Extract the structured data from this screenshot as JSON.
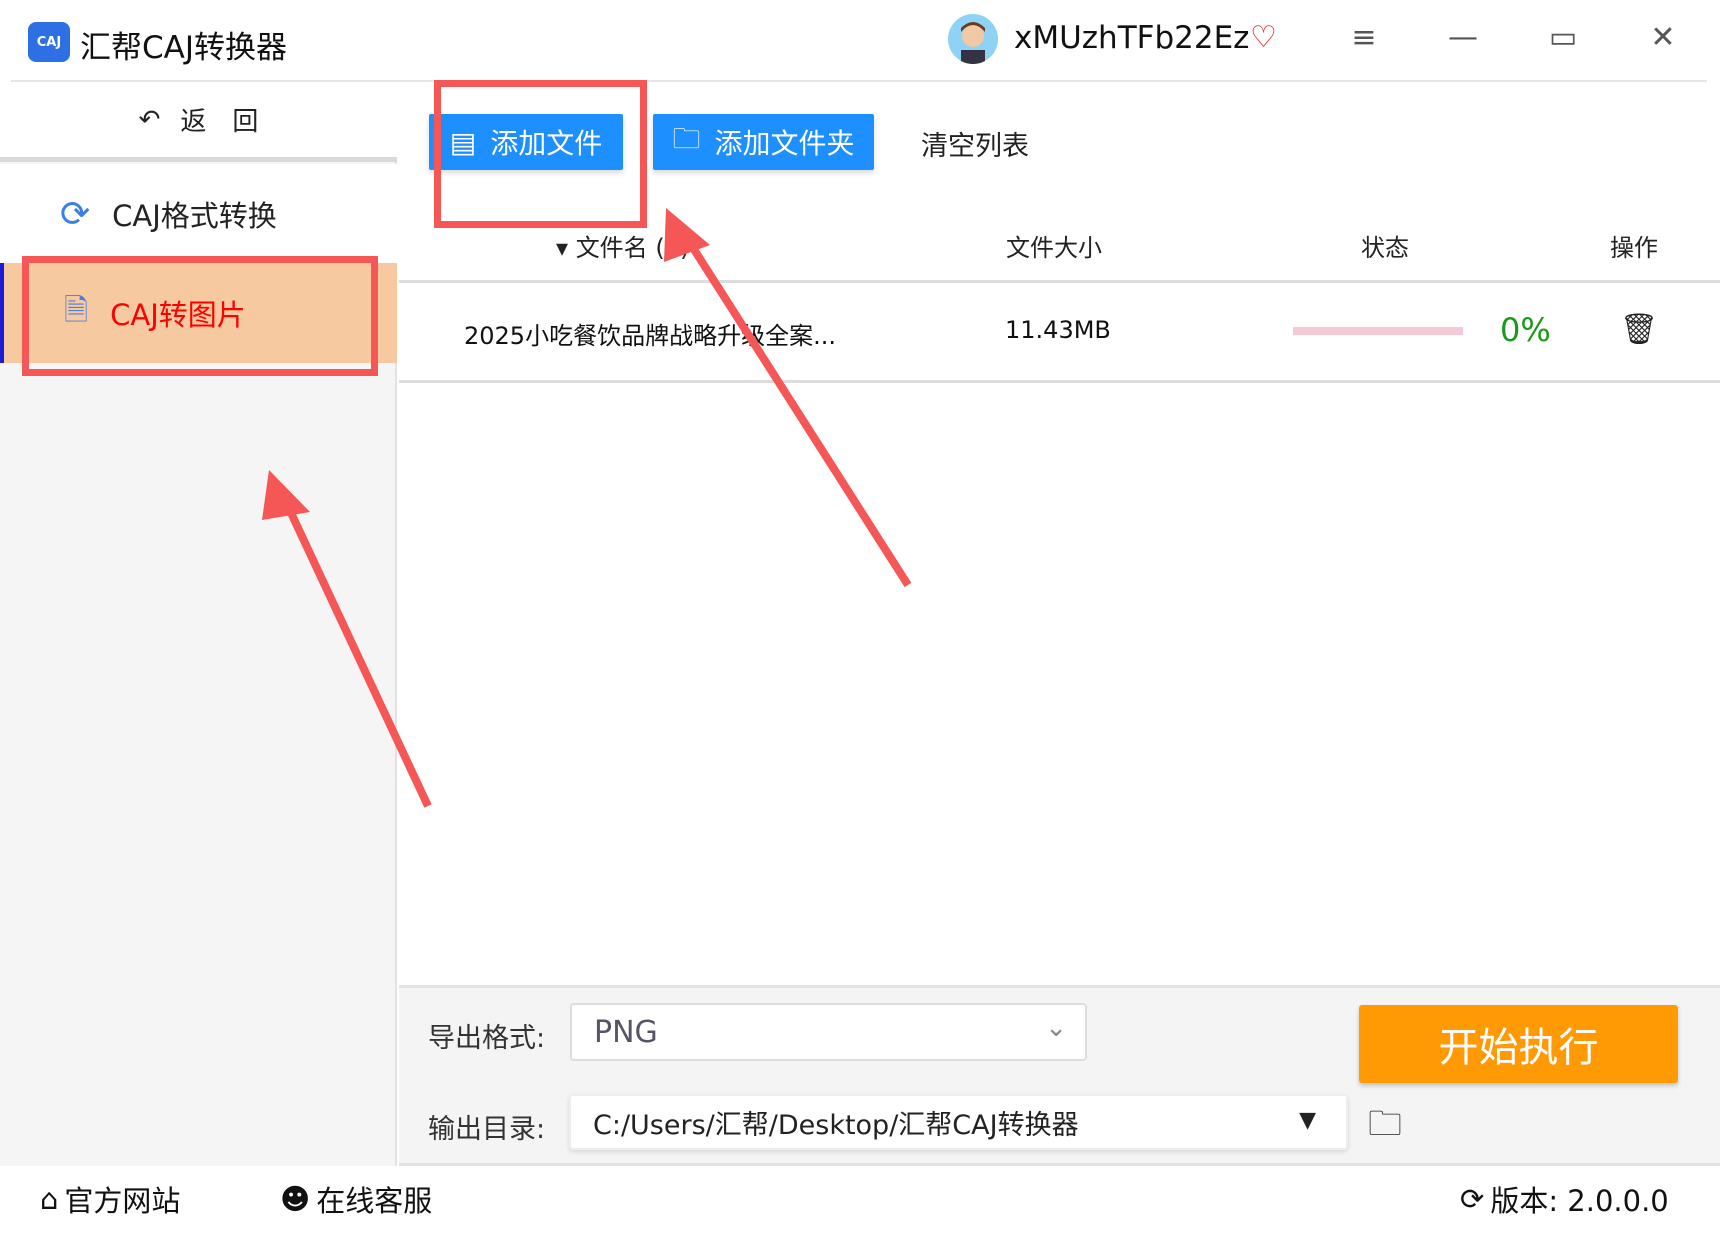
{
  "app": {
    "title": "汇帮CAJ转换器",
    "logo_text": "CAJ",
    "username": "xMUzhTFb22Ez"
  },
  "window_controls": {
    "menu": "≡",
    "minimize": "—",
    "maximize": "▭",
    "close": "✕"
  },
  "sidebar": {
    "back_label": "返　回",
    "items": [
      {
        "label": "CAJ格式转换",
        "icon": "refresh-icon",
        "selected": false
      },
      {
        "label": "CAJ转图片",
        "icon": "document-icon",
        "selected": true
      }
    ]
  },
  "toolbar": {
    "add_file": "添加文件",
    "add_folder": "添加文件夹",
    "clear_list": "清空列表"
  },
  "table": {
    "headers": {
      "name": "文件名 (1)",
      "size": "文件大小",
      "status": "状态",
      "action": "操作"
    },
    "rows": [
      {
        "name": "2025小吃餐饮品牌战略升级全案...",
        "size": "11.43MB",
        "progress": 0,
        "progress_text": "0%"
      }
    ]
  },
  "settings": {
    "format_label": "导出格式:",
    "format_value": "PNG",
    "output_label": "输出目录:",
    "output_value": "C:/Users/汇帮/Desktop/汇帮CAJ转换器",
    "start_button": "开始执行"
  },
  "footer": {
    "website": "官方网站",
    "support": "在线客服",
    "version": "版本:  2.0.0.0"
  },
  "colors": {
    "accent": "#1e8ffe",
    "start": "#ff9a05",
    "selected_bg": "#f7c9a0",
    "annotation": "#f55656",
    "progress_done": "#1a9a1a"
  }
}
